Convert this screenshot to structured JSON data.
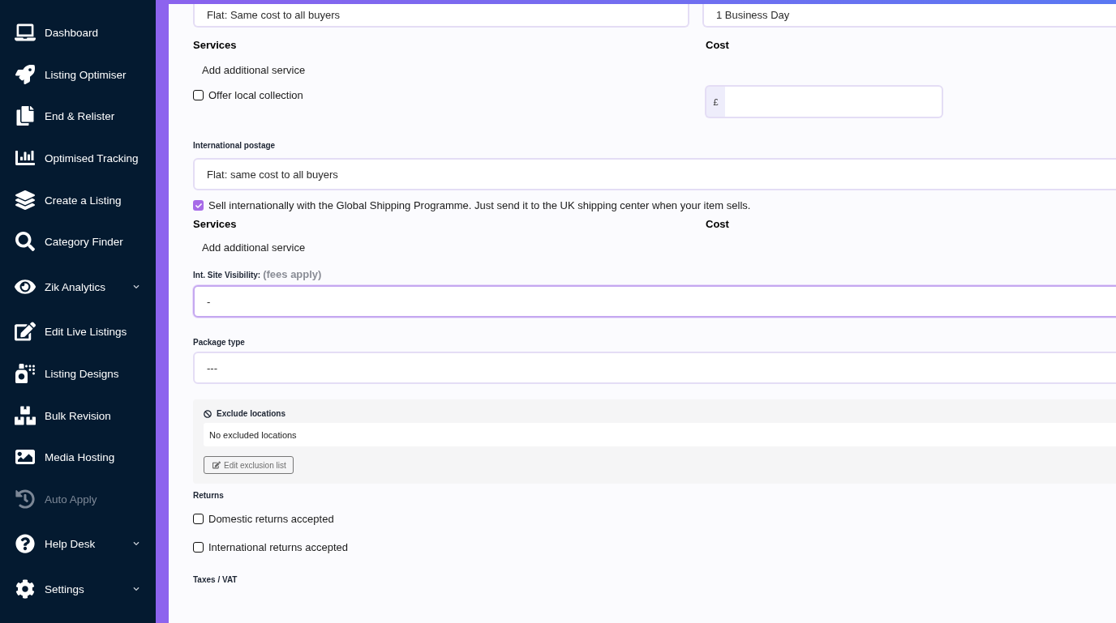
{
  "sidebar": {
    "items": [
      {
        "label": "Dashboard",
        "disabled": false,
        "expandable": false
      },
      {
        "label": "Listing Optimiser",
        "disabled": false,
        "expandable": false
      },
      {
        "label": "End & Relister",
        "disabled": false,
        "expandable": false
      },
      {
        "label": "Optimised Tracking",
        "disabled": false,
        "expandable": false
      },
      {
        "label": "Create a Listing",
        "disabled": false,
        "expandable": false
      },
      {
        "label": "Category Finder",
        "disabled": false,
        "expandable": false
      },
      {
        "label": "Zik Analytics",
        "disabled": false,
        "expandable": true
      },
      {
        "label": "Edit Live Listings",
        "disabled": false,
        "expandable": false
      },
      {
        "label": "Listing Designs",
        "disabled": false,
        "expandable": false
      },
      {
        "label": "Bulk Revision",
        "disabled": false,
        "expandable": false
      },
      {
        "label": "Media Hosting",
        "disabled": false,
        "expandable": false
      },
      {
        "label": "Auto Apply",
        "disabled": true,
        "expandable": false
      },
      {
        "label": "Help Desk",
        "disabled": false,
        "expandable": true
      },
      {
        "label": "Settings",
        "disabled": false,
        "expandable": true
      }
    ]
  },
  "domestic": {
    "service_type": "Flat: Same cost to all buyers",
    "handling_time": "1 Business Day",
    "services_heading": "Services",
    "cost_heading": "Cost",
    "add_service": "Add additional service",
    "local_collection": {
      "label": "Offer local collection",
      "checked": false
    },
    "cost_currency": "£"
  },
  "international": {
    "label": "International postage",
    "service_type": "Flat: same cost to all buyers",
    "global_shipping": {
      "label": "Sell internationally with the Global Shipping Programme. Just send it to the UK shipping center when your item sells.",
      "checked": true
    },
    "services_heading": "Services",
    "cost_heading": "Cost",
    "add_service": "Add additional service"
  },
  "site_visibility": {
    "label": "Int. Site Visibility:",
    "note": "(fees apply)",
    "value": "-",
    "focused": true
  },
  "package_type": {
    "label": "Package type",
    "value": "---",
    "focused": false
  },
  "exclude_locations": {
    "title": "Exclude locations",
    "summary": "No excluded locations",
    "button": "Edit exclusion list"
  },
  "returns": {
    "label": "Returns",
    "options": [
      {
        "label": "Domestic returns accepted",
        "checked": false
      },
      {
        "label": "International returns accepted",
        "checked": false
      }
    ]
  },
  "taxes": {
    "label": "Taxes / VAT"
  }
}
